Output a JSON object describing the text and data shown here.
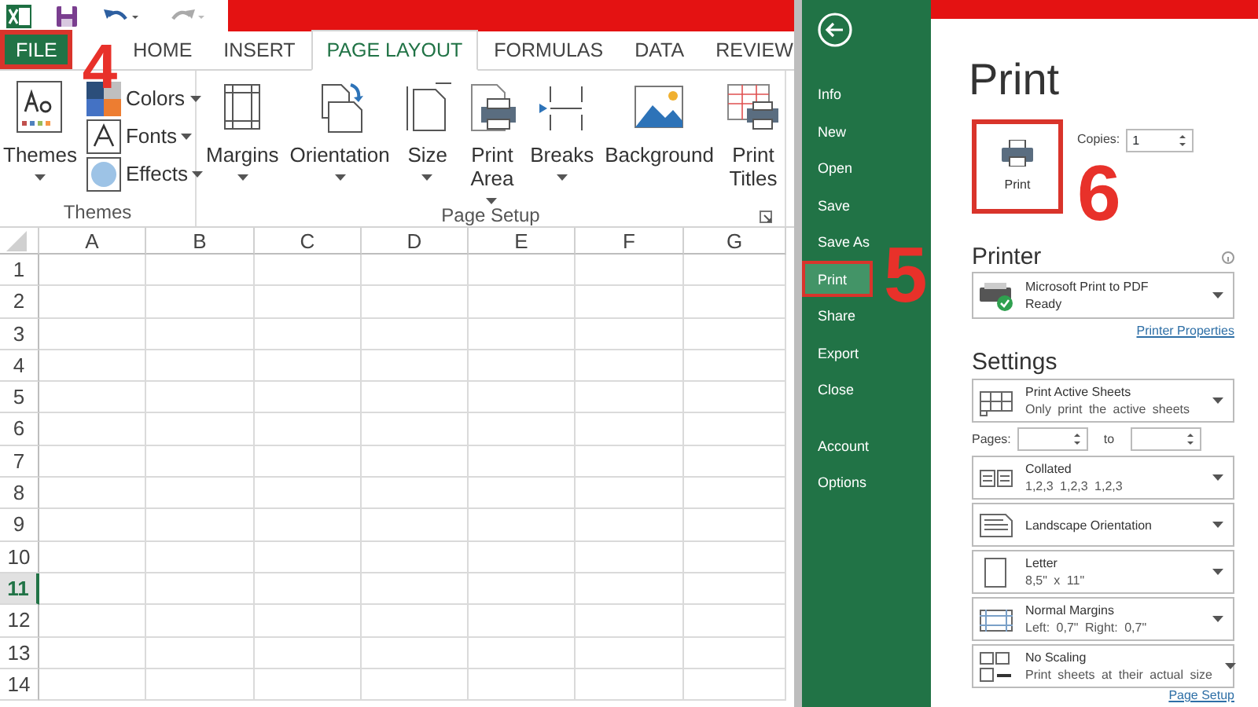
{
  "ribbon": {
    "tabs": [
      {
        "label": "FILE",
        "selected": false,
        "kind": "file",
        "highlighted": true
      },
      {
        "label": "HOME",
        "selected": false,
        "kind": "tab",
        "highlighted": false
      },
      {
        "label": "INSERT",
        "selected": false,
        "kind": "tab",
        "highlighted": false
      },
      {
        "label": "PAGE LAYOUT",
        "selected": true,
        "kind": "tab",
        "highlighted": false
      },
      {
        "label": "FORMULAS",
        "selected": false,
        "kind": "tab",
        "highlighted": false
      },
      {
        "label": "DATA",
        "selected": false,
        "kind": "tab",
        "highlighted": false
      },
      {
        "label": "REVIEW",
        "selected": false,
        "kind": "tab",
        "highlighted": false
      }
    ],
    "groups": [
      {
        "label": "Themes",
        "buttons": [
          {
            "label": "Themes",
            "kind": "large",
            "caret": true
          },
          {
            "label": "Colors",
            "kind": "small",
            "caret": true
          },
          {
            "label": "Fonts",
            "kind": "small",
            "caret": true
          },
          {
            "label": "Effects",
            "kind": "small",
            "caret": true
          }
        ]
      },
      {
        "label": "Page Setup",
        "launcher": true,
        "buttons": [
          {
            "label": "Margins",
            "kind": "large",
            "caret": true
          },
          {
            "label": "Orientation",
            "kind": "large",
            "caret": true
          },
          {
            "label": "Size",
            "kind": "large",
            "caret": true
          },
          {
            "label": "Print Area",
            "kind": "large",
            "caret": true
          },
          {
            "label": "Breaks",
            "kind": "large",
            "caret": true
          },
          {
            "label": "Background",
            "kind": "large",
            "caret": false
          },
          {
            "label": "Print Titles",
            "kind": "large",
            "caret": false
          }
        ]
      }
    ]
  },
  "sheet": {
    "columns": [
      "A",
      "B",
      "C",
      "D",
      "E",
      "F",
      "G"
    ],
    "rows": [
      {
        "label": "1",
        "selected": false
      },
      {
        "label": "2",
        "selected": false
      },
      {
        "label": "3",
        "selected": false
      },
      {
        "label": "4",
        "selected": false
      },
      {
        "label": "5",
        "selected": false
      },
      {
        "label": "6",
        "selected": false
      },
      {
        "label": "7",
        "selected": false
      },
      {
        "label": "8",
        "selected": false
      },
      {
        "label": "9",
        "selected": false
      },
      {
        "label": "10",
        "selected": false
      },
      {
        "label": "11",
        "selected": true
      },
      {
        "label": "12",
        "selected": false
      },
      {
        "label": "13",
        "selected": false
      },
      {
        "label": "14",
        "selected": false
      }
    ]
  },
  "backstage": {
    "nav": [
      {
        "label": "Info",
        "selected": false,
        "highlighted": false
      },
      {
        "label": "New",
        "selected": false,
        "highlighted": false
      },
      {
        "label": "Open",
        "selected": false,
        "highlighted": false
      },
      {
        "label": "Save",
        "selected": false,
        "highlighted": false
      },
      {
        "label": "Save As",
        "selected": false,
        "highlighted": false
      },
      {
        "label": "Print",
        "selected": true,
        "highlighted": true
      },
      {
        "label": "Share",
        "selected": false,
        "highlighted": false
      },
      {
        "label": "Export",
        "selected": false,
        "highlighted": false
      },
      {
        "label": "Close",
        "selected": false,
        "highlighted": false
      }
    ],
    "nav_bottom": [
      {
        "label": "Account",
        "selected": false,
        "highlighted": false
      },
      {
        "label": "Options",
        "selected": false,
        "highlighted": false
      }
    ],
    "title": "Print",
    "print_button": {
      "label": "Print",
      "highlighted": true
    },
    "copies_label": "Copies:",
    "copies_value": "1",
    "printer_heading": "Printer",
    "printer": {
      "name": "Microsoft Print to PDF",
      "status": "Ready"
    },
    "printer_properties": "Printer Properties",
    "settings_heading": "Settings",
    "settings": [
      {
        "kind": "dropdown",
        "title": "Print Active Sheets",
        "subtitle": "Only print the active sheets"
      },
      {
        "kind": "pages",
        "label": "Pages:",
        "to": "to"
      },
      {
        "kind": "dropdown",
        "title": "Collated",
        "subtitle": "1,2,3 1,2,3 1,2,3"
      },
      {
        "kind": "dropdown",
        "title": "Landscape Orientation"
      },
      {
        "kind": "dropdown",
        "title": "Letter",
        "subtitle": "8,5\" x 11\""
      },
      {
        "kind": "dropdown",
        "title": "Normal Margins",
        "subtitle": "Left: 0,7\" Right: 0,7\""
      },
      {
        "kind": "dropdown",
        "title": "No Scaling",
        "subtitle": "Print sheets at their actual size"
      }
    ],
    "page_setup": "Page Setup"
  },
  "annotations": [
    {
      "label": "4"
    },
    {
      "label": "5"
    },
    {
      "label": "6"
    }
  ]
}
